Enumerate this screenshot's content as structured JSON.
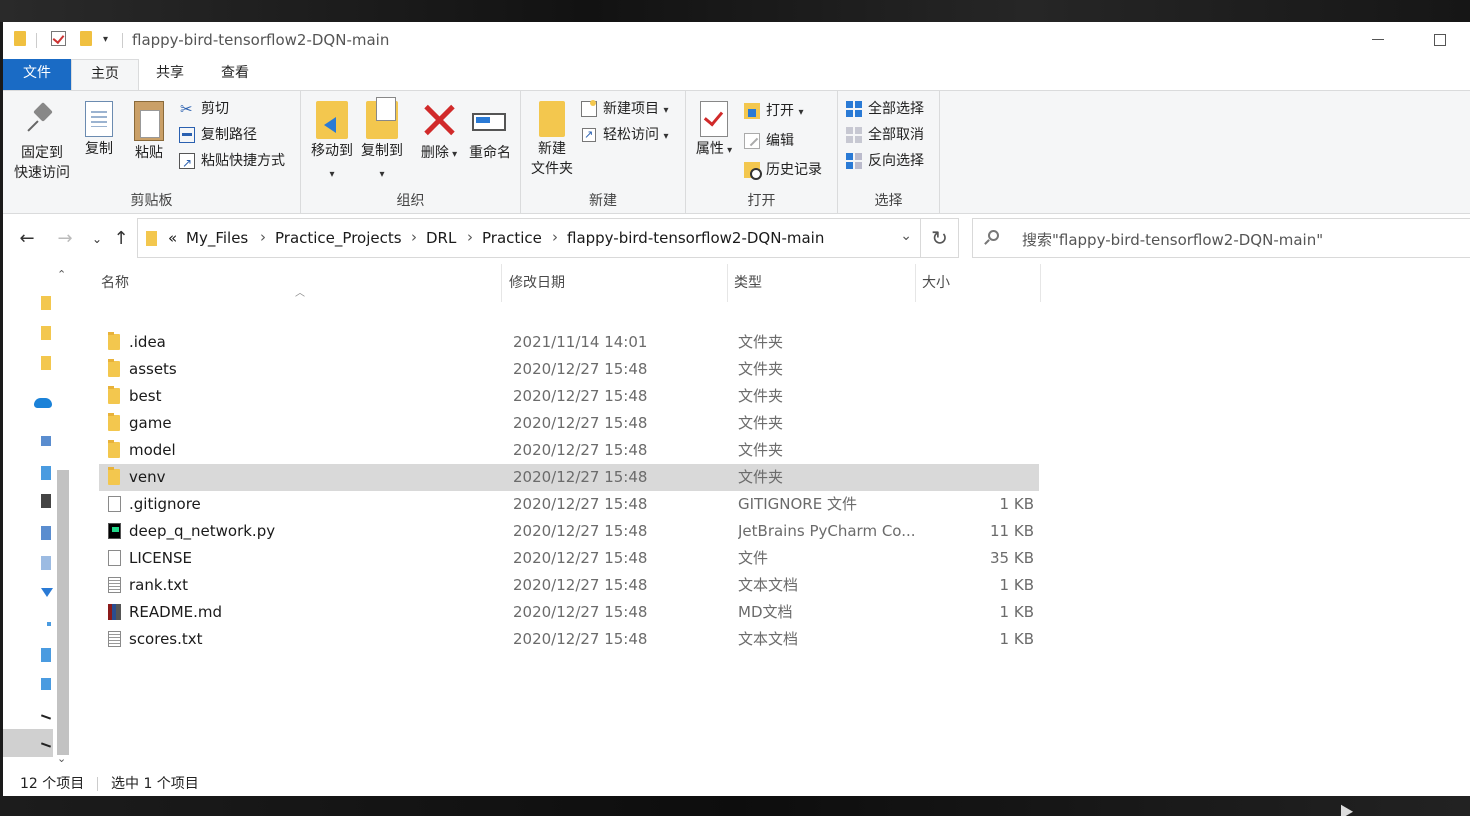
{
  "window": {
    "title": "flappy-bird-tensorflow2-DQN-main"
  },
  "ribbon_tabs": [
    "文件",
    "主页",
    "共享",
    "查看"
  ],
  "ribbon": {
    "clipboard": {
      "label": "剪贴板",
      "pin_line1": "固定到",
      "pin_line2": "快速访问",
      "copy": "复制",
      "paste": "粘贴",
      "cut": "剪切",
      "copy_path": "复制路径",
      "paste_shortcut": "粘贴快捷方式"
    },
    "organize": {
      "label": "组织",
      "move_to": "移动到",
      "copy_to": "复制到",
      "delete": "删除",
      "rename": "重命名"
    },
    "new": {
      "label": "新建",
      "new_folder_line1": "新建",
      "new_folder_line2": "文件夹",
      "new_item": "新建项目",
      "easy_access": "轻松访问"
    },
    "open": {
      "label": "打开",
      "properties": "属性",
      "open": "打开",
      "edit": "编辑",
      "history": "历史记录"
    },
    "select": {
      "label": "选择",
      "select_all": "全部选择",
      "select_none": "全部取消",
      "invert": "反向选择"
    }
  },
  "address": {
    "prefix": "«",
    "crumbs": [
      "My_Files",
      "Practice_Projects",
      "DRL",
      "Practice",
      "flappy-bird-tensorflow2-DQN-main"
    ]
  },
  "search": {
    "placeholder": "搜索\"flappy-bird-tensorflow2-DQN-main\""
  },
  "columns": {
    "name": "名称",
    "modified": "修改日期",
    "type": "类型",
    "size": "大小"
  },
  "files": [
    {
      "name": ".idea",
      "modified": "2021/11/14 14:01",
      "type": "文件夹",
      "size": "",
      "icon": "folder-icon"
    },
    {
      "name": "assets",
      "modified": "2020/12/27 15:48",
      "type": "文件夹",
      "size": "",
      "icon": "folder-icon"
    },
    {
      "name": "best",
      "modified": "2020/12/27 15:48",
      "type": "文件夹",
      "size": "",
      "icon": "folder-icon"
    },
    {
      "name": "game",
      "modified": "2020/12/27 15:48",
      "type": "文件夹",
      "size": "",
      "icon": "folder-icon"
    },
    {
      "name": "model",
      "modified": "2020/12/27 15:48",
      "type": "文件夹",
      "size": "",
      "icon": "folder-icon"
    },
    {
      "name": "venv",
      "modified": "2020/12/27 15:48",
      "type": "文件夹",
      "size": "",
      "icon": "folder-icon",
      "selected": true
    },
    {
      "name": ".gitignore",
      "modified": "2020/12/27 15:48",
      "type": "GITIGNORE 文件",
      "size": "1 KB",
      "icon": "file-icon"
    },
    {
      "name": "deep_q_network.py",
      "modified": "2020/12/27 15:48",
      "type": "JetBrains PyCharm Co...",
      "size": "11 KB",
      "icon": "pycharm-file-icon"
    },
    {
      "name": "LICENSE",
      "modified": "2020/12/27 15:48",
      "type": "文件",
      "size": "35 KB",
      "icon": "file-icon"
    },
    {
      "name": "rank.txt",
      "modified": "2020/12/27 15:48",
      "type": "文本文档",
      "size": "1 KB",
      "icon": "text-file-icon"
    },
    {
      "name": "README.md",
      "modified": "2020/12/27 15:48",
      "type": "MD文档",
      "size": "1 KB",
      "icon": "markdown-file-icon"
    },
    {
      "name": "scores.txt",
      "modified": "2020/12/27 15:48",
      "type": "文本文档",
      "size": "1 KB",
      "icon": "text-file-icon"
    }
  ],
  "status": {
    "count": "12 个项目",
    "selected": "选中 1 个项目"
  },
  "colors": {
    "accent": "#1a6bc5",
    "folder": "#f3c74e",
    "selection": "#d9d9d9"
  }
}
